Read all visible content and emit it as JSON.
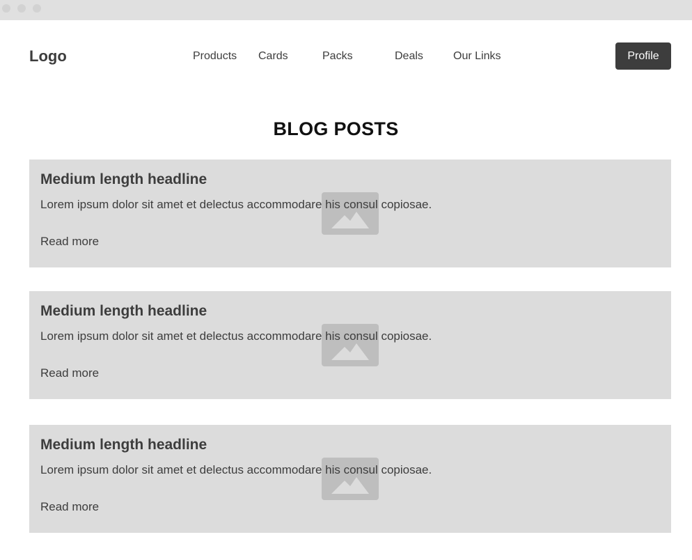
{
  "header": {
    "logo": "Logo",
    "nav": [
      "Products",
      "Cards",
      "Packs",
      "Deals",
      "Our Links"
    ],
    "profile_label": "Profile"
  },
  "main": {
    "title": "BLOG POSTS",
    "posts": [
      {
        "headline": "Medium length headline",
        "body": "Lorem ipsum dolor sit amet et delectus accommodare his consul copiosae.",
        "link": "Read more",
        "image_icon": "image-placeholder-icon"
      },
      {
        "headline": "Medium length headline",
        "body": "Lorem ipsum dolor sit amet et delectus accommodare his consul copiosae.",
        "link": "Read more",
        "image_icon": "image-placeholder-icon"
      },
      {
        "headline": "Medium length headline",
        "body": "Lorem ipsum dolor sit amet et delectus accommodare his consul copiosae.",
        "link": "Read more",
        "image_icon": "image-placeholder-icon"
      }
    ]
  },
  "colors": {
    "text": "#3d3d3d",
    "button_bg": "#3d3d3d",
    "card_bg": "#dcdcdc",
    "placeholder": "#bebebe",
    "titlebar": "#e0e0e0"
  }
}
